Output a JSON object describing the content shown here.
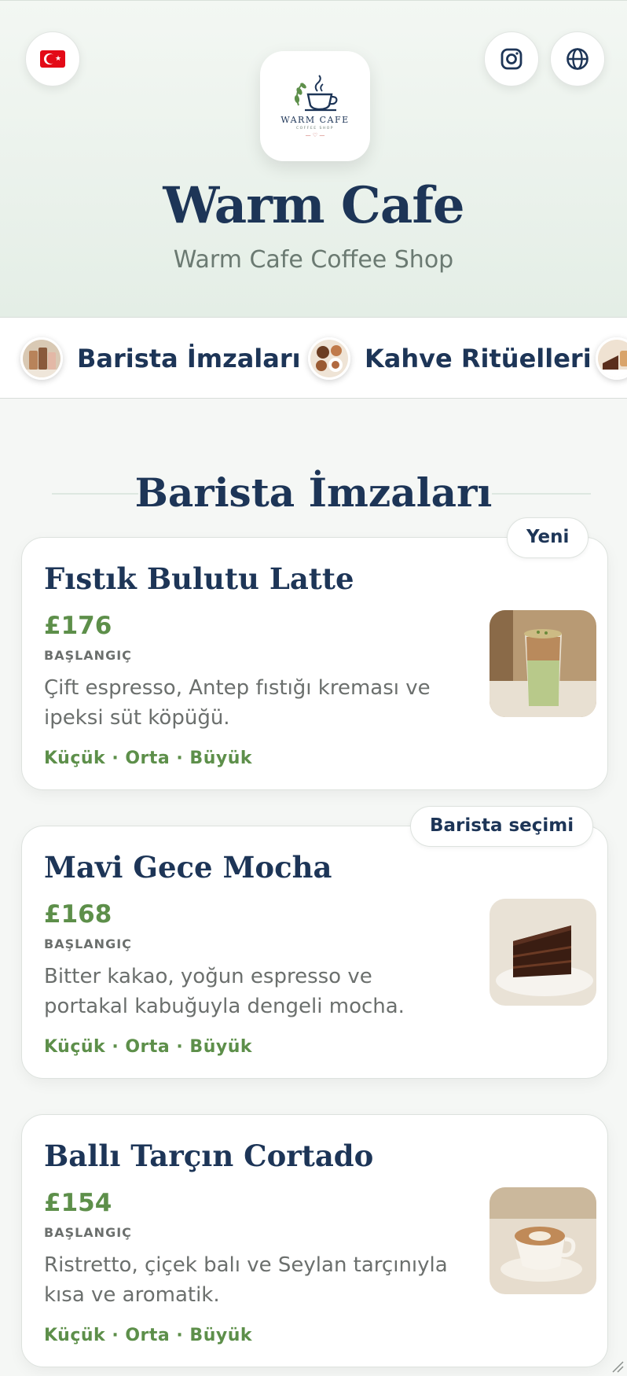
{
  "header": {
    "title": "Warm Cafe",
    "subtitle": "Warm Cafe Coffee Shop",
    "logo_text": "WARM CAFE",
    "logo_subtext": "COFFEE SHOP",
    "language_flag_icon": "turkey-flag-icon",
    "instagram_icon": "instagram-icon",
    "website_icon": "globe-icon"
  },
  "categories": [
    {
      "label": "Barista İmzaları",
      "icon": "iced-coffee-thumbnail"
    },
    {
      "label": "Kahve Ritüelleri",
      "icon": "coffee-beans-thumbnail"
    },
    {
      "label": "",
      "icon": "dessert-thumbnail"
    }
  ],
  "section": {
    "title": "Barista İmzaları"
  },
  "items": [
    {
      "name": "Fıstık Bulutu Latte",
      "price": "£176",
      "price_note": "BAŞLANGIÇ",
      "description": "Çift espresso, Antep fıstığı kreması ve ipeksi süt köpüğü.",
      "sizes": "Küçük · Orta · Büyük",
      "badge": "Yeni",
      "image": "iced-pistachio-latte"
    },
    {
      "name": "Mavi Gece Mocha",
      "price": "£168",
      "price_note": "BAŞLANGIÇ",
      "description": "Bitter kakao, yoğun espresso ve portakal kabuğuyla dengeli mocha.",
      "sizes": "Küçük · Orta · Büyük",
      "badge": "Barista seçimi",
      "image": "chocolate-cake-slice"
    },
    {
      "name": "Ballı Tarçın Cortado",
      "price": "£154",
      "price_note": "BAŞLANGIÇ",
      "description": "Ristretto, çiçek balı ve Seylan tarçınıyla kısa ve aromatik.",
      "sizes": "Küçük · Orta · Büyük",
      "badge": "",
      "image": "latte-art-cup"
    }
  ],
  "colors": {
    "navy": "#1d3557",
    "green": "#5d8f4a",
    "muted": "#6b6f6d",
    "header_bg": "#e4eee6"
  }
}
